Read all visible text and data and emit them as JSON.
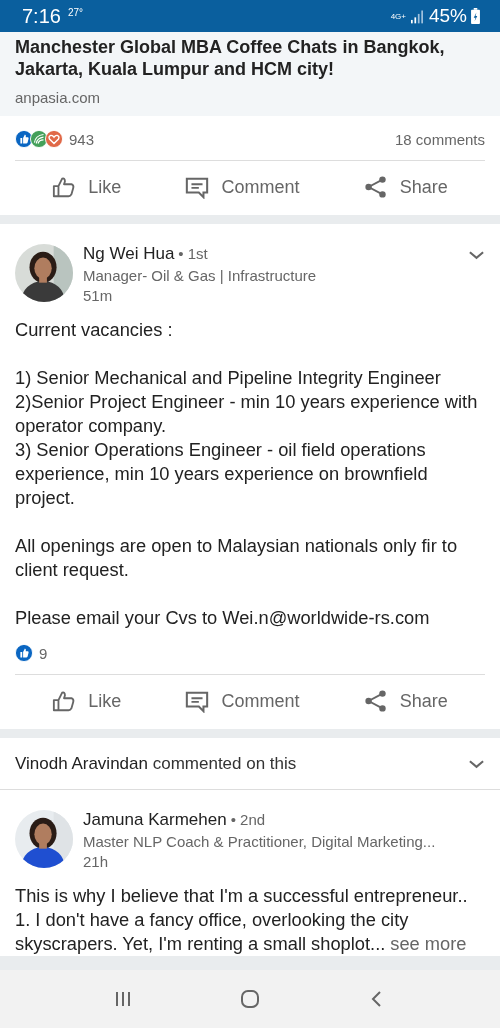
{
  "status_bar": {
    "time": "7:16",
    "temperature": "27°",
    "network": "4G+",
    "battery": "45%"
  },
  "feed": [
    {
      "kind": "shared_link",
      "link": {
        "title": "Manchester Global MBA Coffee Chats in Bangkok, Jakarta, Kuala Lumpur and HCM city!",
        "domain": "anpasia.com"
      },
      "reactions": [
        {
          "kind": "like"
        },
        {
          "kind": "celebrate"
        },
        {
          "kind": "love"
        }
      ],
      "reaction_count": "943",
      "comments": "18 comments",
      "actions": [
        {
          "kind": "like",
          "label": "Like"
        },
        {
          "kind": "comment",
          "label": "Comment"
        },
        {
          "kind": "share",
          "label": "Share"
        }
      ]
    },
    {
      "kind": "post",
      "author": {
        "name": "Ng Wei Hua",
        "degree": "• 1st",
        "headline": "Manager- Oil & Gas | Infrastructure",
        "time": "51m"
      },
      "body": [
        "Current vacancies :",
        "1) Senior Mechanical and Pipeline Integrity Engineer\n2)Senior Project Engineer - min 10 years experience with operator company.\n3) Senior Operations Engineer - oil field operations experience, min 10 years experience on brownfield project.",
        "All openings are open to Malaysian nationals only fir to client request.",
        "Please email your Cvs to Wei.n@worldwide-rs.com"
      ],
      "reactions": [
        {
          "kind": "like"
        }
      ],
      "reaction_count": "9",
      "actions": [
        {
          "kind": "like",
          "label": "Like"
        },
        {
          "kind": "comment",
          "label": "Comment"
        },
        {
          "kind": "share",
          "label": "Share"
        }
      ]
    },
    {
      "kind": "commented_post",
      "context": "**Vinodh Aravindan** commented on this",
      "author": {
        "name": "Jamuna Karmehen",
        "degree": "• 2nd",
        "headline": "Master NLP Coach & Practitioner, Digital Marketing...",
        "time": "21h"
      },
      "body": [
        "This is why I believe that I'm a successful entrepreneur..\n1. I don't have a fancy office, overlooking the city skyscrapers. Yet, I'm renting a small shoplot..."
      ],
      "see_more": "see more"
    }
  ]
}
